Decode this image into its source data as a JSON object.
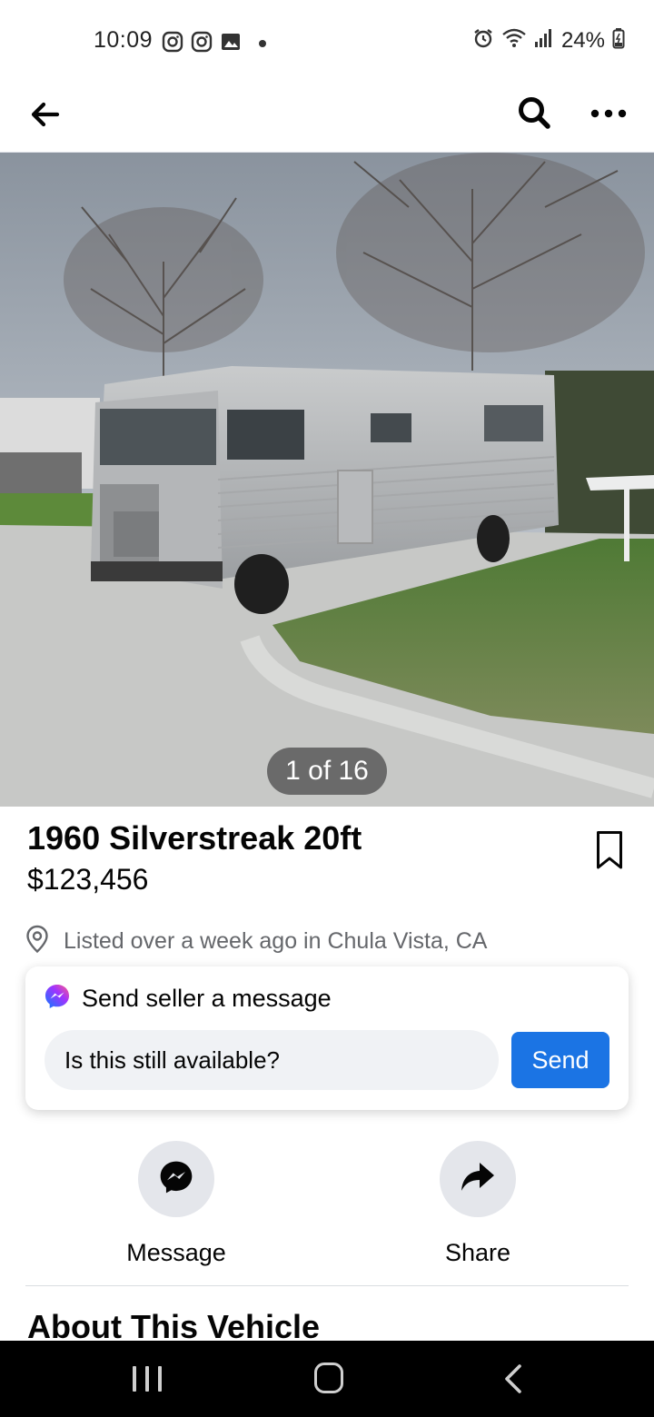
{
  "status_bar": {
    "time": "10:09",
    "battery": "24%",
    "icons_left": [
      "instagram-icon",
      "instagram-icon",
      "gallery-icon",
      "dot-icon"
    ],
    "icons_right": [
      "alarm-icon",
      "wifi-icon",
      "signal-icon",
      "battery-icon"
    ]
  },
  "app_bar": {
    "icons": [
      "back-arrow-icon",
      "search-icon",
      "more-icon"
    ]
  },
  "photo": {
    "counter": "1 of 16"
  },
  "listing": {
    "title": "1960 Silverstreak 20ft",
    "price": "$123,456",
    "location": "Listed over a week ago in Chula Vista, CA"
  },
  "message_card": {
    "header": "Send seller a message",
    "input_value": "Is this still available?",
    "send_label": "Send",
    "accent": "#1b74e4"
  },
  "actions": {
    "message_label": "Message",
    "share_label": "Share"
  },
  "section": {
    "title": "About This Vehicle"
  },
  "nav_bar": {
    "icons": [
      "recents-icon",
      "home-icon",
      "nav-back-icon"
    ]
  }
}
